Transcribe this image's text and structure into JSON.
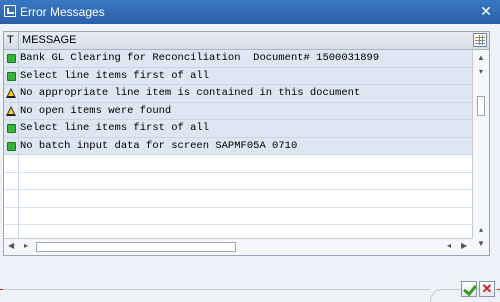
{
  "window": {
    "title": "Error Messages"
  },
  "grid": {
    "columns": [
      "T",
      "MESSAGE"
    ],
    "rows": [
      {
        "type": "ok",
        "message": "Bank GL Clearing for Reconciliation  Document# 1500031899"
      },
      {
        "type": "ok",
        "message": "Select line items first of all"
      },
      {
        "type": "warning",
        "message": "No appropriate line item is contained in this document"
      },
      {
        "type": "warning",
        "message": "No open items were found"
      },
      {
        "type": "ok",
        "message": "Select line items first of all"
      },
      {
        "type": "ok",
        "message": "No batch input data for screen SAPMF05A 0710"
      }
    ]
  },
  "icons": {
    "ok": "green-status-icon",
    "warning": "warning-triangle-icon",
    "settings": "layout-settings-icon",
    "confirm": "checkmark-icon",
    "cancel": "close-icon"
  },
  "colors": {
    "titlebar": "#2f68b2",
    "row_fill": "#dde6f1",
    "ok": "#36b33a",
    "warning": "#f7d21a",
    "cancel": "#d21a1a"
  }
}
